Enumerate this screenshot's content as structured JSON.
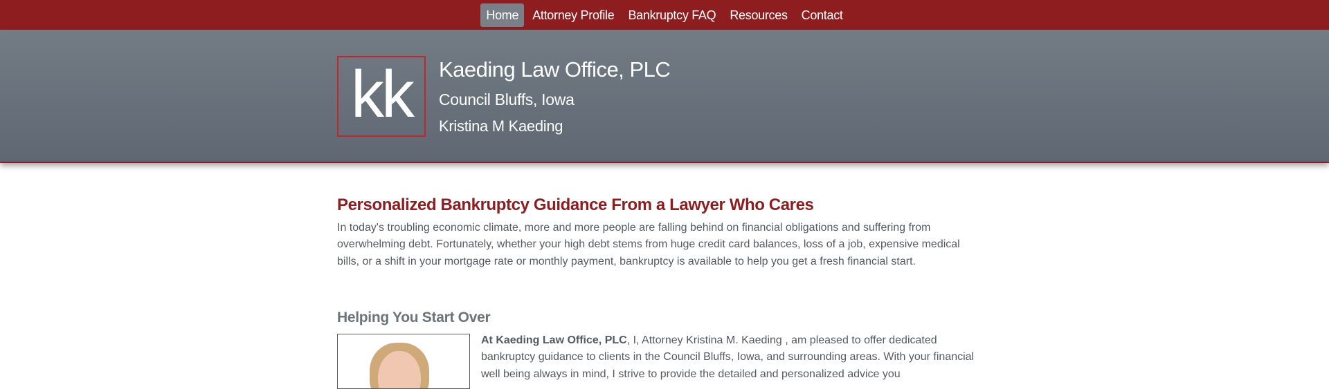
{
  "nav": {
    "items": [
      {
        "label": "Home",
        "active": true
      },
      {
        "label": "Attorney Profile",
        "active": false
      },
      {
        "label": "Bankruptcy FAQ",
        "active": false
      },
      {
        "label": "Resources",
        "active": false
      },
      {
        "label": "Contact",
        "active": false
      }
    ]
  },
  "header": {
    "logo_text": "kk",
    "firm_name": "Kaeding Law Office, PLC",
    "location": "Council Bluffs, Iowa",
    "attorney": "Kristina M Kaeding"
  },
  "main": {
    "heading": "Personalized Bankruptcy Guidance From a Lawyer Who Cares",
    "intro": "In today's troubling economic climate, more and more people are falling behind on financial obligations and suffering from overwhelming debt. Fortunately, whether your high debt stems from huge credit card balances, loss of a job, expensive medical bills, or a shift in your mortgage rate or monthly payment, bankruptcy is available to help you get a fresh financial start.",
    "subheading": "Helping You Start Over",
    "bio_bold": "At Kaeding Law Office, PLC",
    "bio_text": ", I, Attorney Kristina M. Kaeding , am pleased to offer dedicated bankruptcy guidance to clients in the Council Bluffs, Iowa, and surrounding areas. With your financial well being always in mind, I strive to provide the detailed and personalized advice you"
  },
  "colors": {
    "nav_bg": "#8e1d20",
    "nav_active_bg": "#7a8088",
    "banner_top": "#737c85",
    "banner_bottom": "#5f6872",
    "accent": "#8e1d20",
    "body_text": "#555a60"
  }
}
